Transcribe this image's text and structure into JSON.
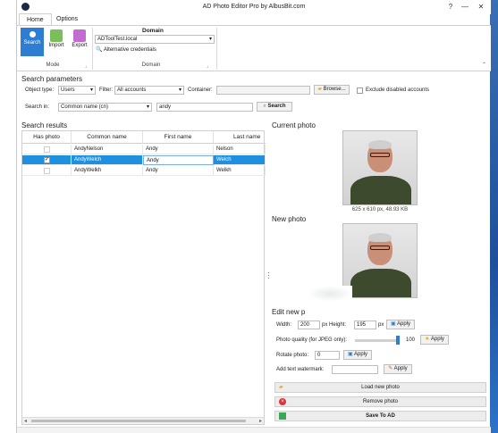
{
  "window": {
    "title": "AD Photo Editor Pro by AlbusBit.com",
    "help": "?",
    "minimize": "—",
    "maximize": "☐",
    "close": "✕"
  },
  "tabs": [
    {
      "label": "Home"
    },
    {
      "label": "Options"
    }
  ],
  "ribbon": {
    "mode": {
      "label": "Mode",
      "buttons": [
        {
          "label": "Search"
        },
        {
          "label": "Import"
        },
        {
          "label": "Export"
        }
      ]
    },
    "domain": {
      "label": "Domain",
      "title": "Domain",
      "value": "ADToolTest.local",
      "alt_credentials": "Alternative credentials"
    }
  },
  "search": {
    "heading": "Search parameters",
    "object_type_label": "Object type:",
    "object_type": "Users",
    "filter_label": "Filter:",
    "filter": "All accounts",
    "container_label": "Container:",
    "container": "",
    "browse": "Browse...",
    "exclude_disabled": "Exclude disabled accounts",
    "search_in_label": "Search in:",
    "search_in": "Common name (cn)",
    "query": "andy",
    "search_button": "Search"
  },
  "results": {
    "heading": "Search results",
    "columns": [
      "Has photo",
      "Common name",
      "First name",
      "Last name"
    ],
    "rows": [
      {
        "has_photo": false,
        "common_name": "AndyNelson",
        "first_name": "Andy",
        "last_name": "Nelson"
      },
      {
        "has_photo": true,
        "common_name": "AndyWelch",
        "first_name": "Andy",
        "last_name": "Welch"
      },
      {
        "has_photo": false,
        "common_name": "AndyWelkh",
        "first_name": "Andy",
        "last_name": "Welkh"
      }
    ]
  },
  "current_photo": {
    "heading": "Current photo",
    "info": "625 x 610 px, 48.93 KB"
  },
  "new_photo": {
    "heading": "New photo"
  },
  "edit": {
    "heading": "Edit new p",
    "width_label": "Width:",
    "width": "200",
    "px1": "px",
    "height_label": "Height:",
    "height": "195",
    "px2": "px",
    "apply": "Apply",
    "quality_label": "Photo quality (for JPEG only):",
    "quality": "100",
    "rotate_label": "Rotate photo:",
    "rotate": "0",
    "watermark_label": "Add text watermark:",
    "watermark": ""
  },
  "actions": {
    "load": "Load new photo",
    "remove": "Remove photo",
    "save": "Save To AD"
  },
  "colors": {
    "accent": "#2d7dd2",
    "selection": "#1f8fe0"
  }
}
